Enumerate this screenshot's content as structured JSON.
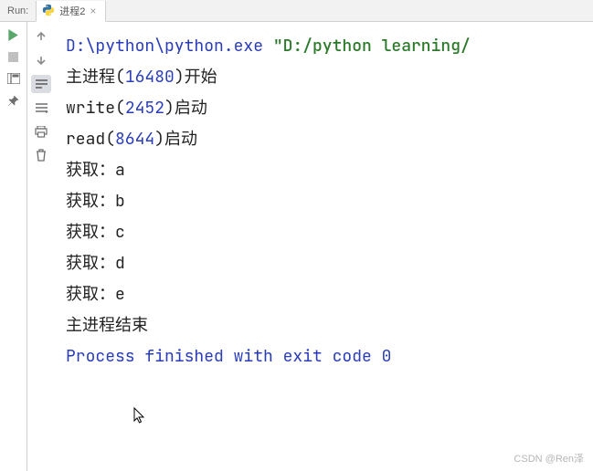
{
  "tabbar": {
    "run_label": "Run:",
    "active_tab": "进程2",
    "close_glyph": "×"
  },
  "console": {
    "line1_prefix": "D:\\python\\python.exe ",
    "line1_arg": "\"D:/python learning/",
    "line2_a": "主进程(",
    "line2_b": "16480",
    "line2_c": ")开始",
    "line3_a": "write(",
    "line3_b": "2452",
    "line3_c": ")启动",
    "line4_a": "read(",
    "line4_b": "8644",
    "line4_c": ")启动",
    "line5": "获取：a",
    "line6": "获取：b",
    "line7": "获取：c",
    "line8": "获取：d",
    "line9": "获取：e",
    "line10": "主进程结束",
    "line_blank": " ",
    "line12": "Process finished with exit code 0"
  },
  "watermark": "CSDN @Ren泽"
}
